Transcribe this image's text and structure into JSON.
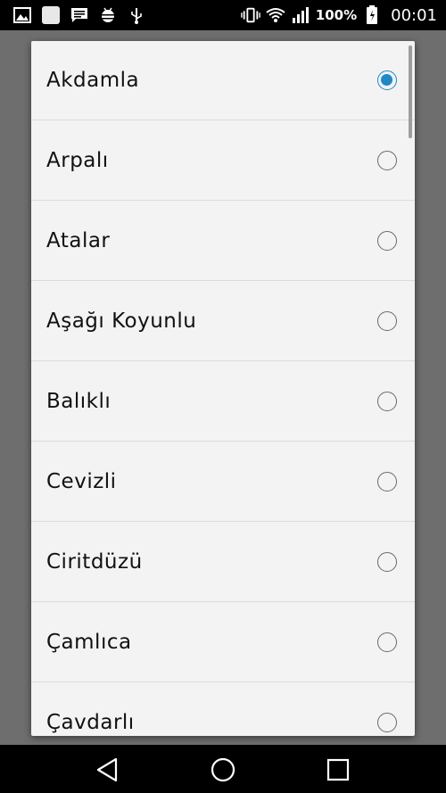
{
  "status_bar": {
    "battery_percent": "100%",
    "time": "00:01",
    "left_icons": [
      "gallery-icon",
      "app-icon",
      "message-icon",
      "android-debug-icon",
      "usb-icon"
    ],
    "right_icons": [
      "vibrate-icon",
      "wifi-icon",
      "signal-icon",
      "battery-icon"
    ]
  },
  "dialog": {
    "options": [
      {
        "label": "Akdamla",
        "selected": true
      },
      {
        "label": "Arpalı",
        "selected": false
      },
      {
        "label": "Atalar",
        "selected": false
      },
      {
        "label": "Aşağı Koyunlu",
        "selected": false
      },
      {
        "label": "Balıklı",
        "selected": false
      },
      {
        "label": "Cevizli",
        "selected": false
      },
      {
        "label": "Ciritdüzü",
        "selected": false
      },
      {
        "label": "Çamlıca",
        "selected": false
      },
      {
        "label": "Çavdarlı",
        "selected": false
      }
    ]
  },
  "colors": {
    "accent": "#1e88c8",
    "dialog_bg": "#f3f3f3",
    "scrim": "#6f6f6f"
  },
  "nav_bar": {
    "buttons": [
      "back-icon",
      "home-icon",
      "recents-icon"
    ]
  }
}
